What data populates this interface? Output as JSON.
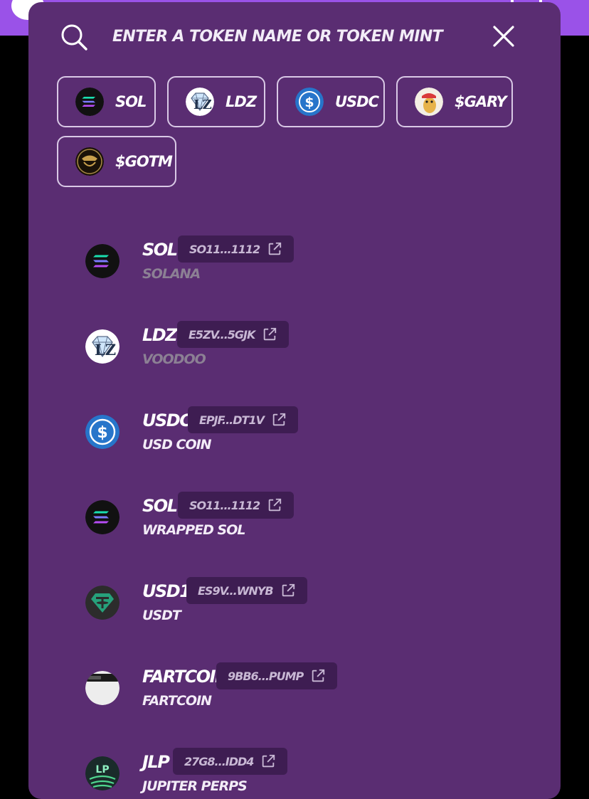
{
  "search": {
    "placeholder": "Enter a token name or token mint"
  },
  "quick_tokens": [
    {
      "label": "SOL",
      "icon": "solana-icon"
    },
    {
      "label": "LDZ",
      "icon": "ldz-diamond-icon"
    },
    {
      "label": "USDC",
      "icon": "usdc-icon"
    },
    {
      "label": "$GARY",
      "icon": "gary-avatar-icon"
    },
    {
      "label": "$GOTM",
      "icon": "gotm-avatar-icon"
    }
  ],
  "tokens": [
    {
      "symbol": "SOL",
      "address": "So11...1112",
      "name": "Solana",
      "icon": "solana-icon"
    },
    {
      "symbol": "LDZ",
      "address": "E5ZV...5GJK",
      "name": "Voodoo",
      "icon": "ldz-diamond-icon"
    },
    {
      "symbol": "USDC",
      "address": "EPjF...Dt1v",
      "name": "USD Coin",
      "icon": "usdc-icon"
    },
    {
      "symbol": "SOL",
      "address": "So11...1112",
      "name": "Wrapped SOL",
      "icon": "solana-icon"
    },
    {
      "symbol": "USD1",
      "address": "Es9v...wNYB",
      "name": "USDT",
      "icon": "tether-icon"
    },
    {
      "symbol": "Fartcoin",
      "address": "9BB6...pump",
      "name": "Fartcoin",
      "icon": "fartcoin-icon"
    },
    {
      "symbol": "JLP",
      "address": "27G8...idD4",
      "name": "Jupiter Perps",
      "icon": "jlp-icon"
    }
  ],
  "colors": {
    "modal_bg": "#5a2d72",
    "header_bar": "#9a52e8",
    "address_pill": "#3e1d52",
    "muted_text": "#8c8094"
  }
}
